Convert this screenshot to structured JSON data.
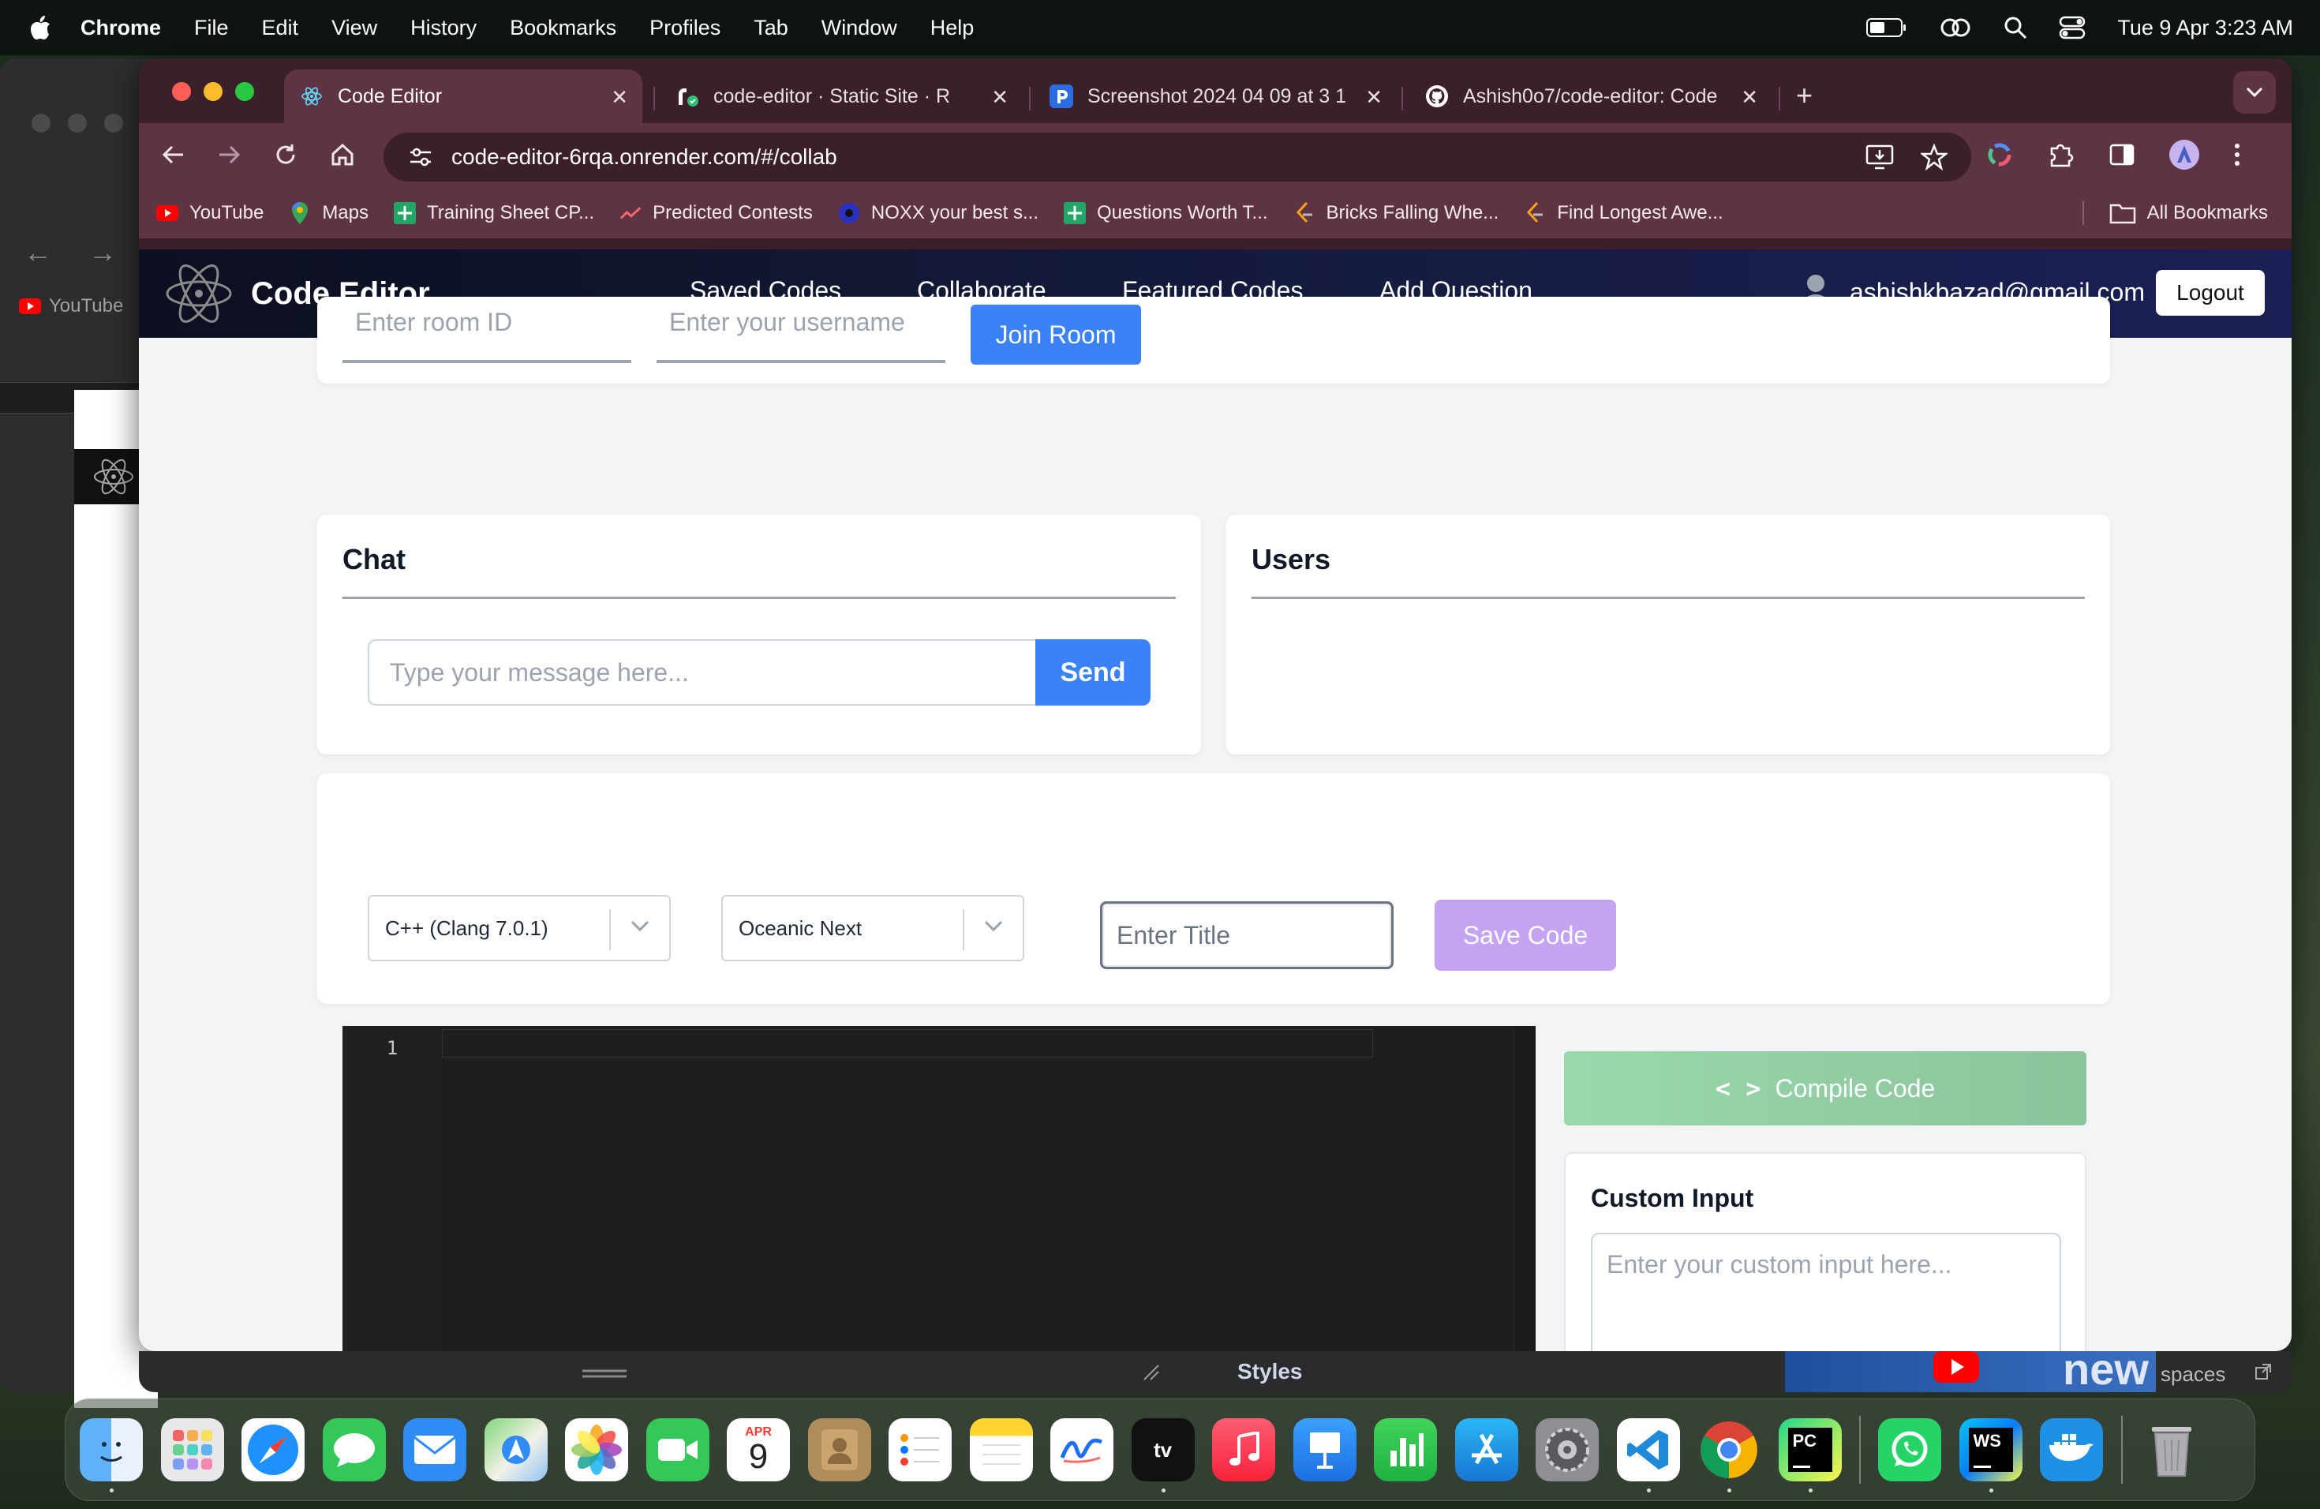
{
  "menubar": {
    "app": "Chrome",
    "items": [
      "File",
      "Edit",
      "View",
      "History",
      "Bookmarks",
      "Profiles",
      "Tab",
      "Window",
      "Help"
    ],
    "datetime": "Tue 9 Apr  3:23 AM"
  },
  "background_window": {
    "bookmark": "YouTube"
  },
  "tabs": [
    {
      "title": "Code Editor",
      "favicon": "react-icon"
    },
    {
      "title": "code-editor · Static Site · R",
      "favicon": "render-icon"
    },
    {
      "title": "Screenshot 2024 04 09 at 3 1",
      "favicon": "p-icon"
    },
    {
      "title": "Ashish0o7/code-editor: Code",
      "favicon": "github-icon"
    }
  ],
  "address": {
    "url": "code-editor-6rqa.onrender.com/#/collab"
  },
  "bookmarks": [
    {
      "label": "YouTube",
      "icon": "youtube-icon"
    },
    {
      "label": "Maps",
      "icon": "maps-icon"
    },
    {
      "label": "Training Sheet CP...",
      "icon": "sheets-icon"
    },
    {
      "label": "Predicted Contests",
      "icon": "trend-icon"
    },
    {
      "label": "NOXX your best s...",
      "icon": "noxx-icon"
    },
    {
      "label": "Questions Worth T...",
      "icon": "sheets-icon"
    },
    {
      "label": "Bricks Falling Whe...",
      "icon": "leetcode-icon"
    },
    {
      "label": "Find Longest Awe...",
      "icon": "leetcode-icon"
    }
  ],
  "all_bookmarks": "All Bookmarks",
  "app": {
    "brand": "Code Editor",
    "nav": [
      "Saved Codes",
      "Collaborate",
      "Featured Codes",
      "Add Question"
    ],
    "user_email": "ashishkbazad@gmail.com",
    "logout": "Logout"
  },
  "room": {
    "room_placeholder": "Enter room ID",
    "username_placeholder": "Enter your username",
    "join": "Join Room"
  },
  "chat": {
    "title": "Chat",
    "placeholder": "Type your message here...",
    "send": "Send"
  },
  "users": {
    "title": "Users"
  },
  "controls": {
    "language": "C++ (Clang 7.0.1)",
    "theme": "Oceanic Next",
    "title_placeholder": "Enter Title",
    "save": "Save Code"
  },
  "editor": {
    "line_numbers": [
      "1"
    ]
  },
  "compile": {
    "label": "Compile Code"
  },
  "custom_input": {
    "title": "Custom Input",
    "placeholder": "Enter your custom input here..."
  },
  "behind": {
    "styles": "Styles",
    "spaces": "spaces",
    "new": "new"
  },
  "dock_apps": [
    "Finder",
    "Launchpad",
    "Safari",
    "Messages",
    "Mail",
    "Maps",
    "Photos",
    "FaceTime",
    "Calendar",
    "Contacts",
    "Reminders",
    "Notes",
    "Freeform",
    "TV",
    "Music",
    "Keynote",
    "Numbers",
    "App Store",
    "System Settings",
    "VS Code",
    "Chrome",
    "PyCharm",
    "WhatsApp",
    "WebStorm",
    "Docker",
    "Trash"
  ],
  "calendar": {
    "month": "APR",
    "day": "9"
  },
  "colors": {
    "accent_blue": "#3b82f6",
    "save_purple": "#c4a3f2",
    "compile_green": "#98d9aa",
    "nav_dark": "#0c0f1f",
    "chrome_frame": "#3b1f2b"
  }
}
